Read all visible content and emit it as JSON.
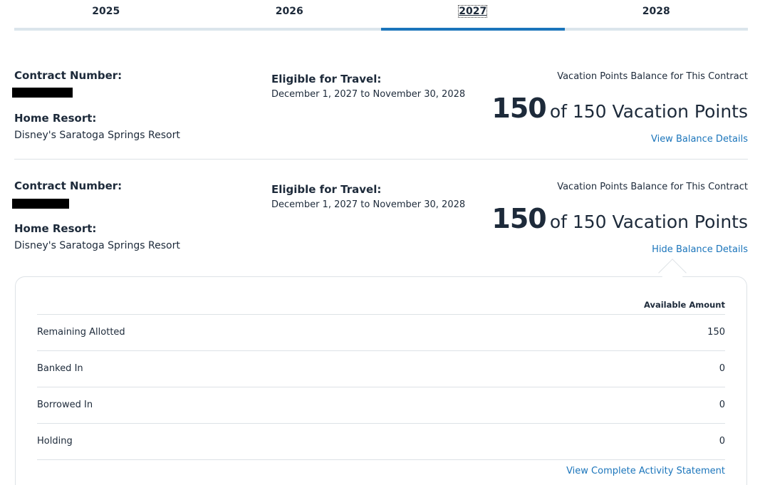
{
  "tabs": [
    {
      "label": "2025",
      "active": false
    },
    {
      "label": "2026",
      "active": false
    },
    {
      "label": "2027",
      "active": true
    },
    {
      "label": "2028",
      "active": false
    }
  ],
  "contracts": [
    {
      "contract_number_label": "Contract Number:",
      "contract_number_value": "[redacted]",
      "home_resort_label": "Home Resort:",
      "home_resort_value": "Disney's Saratoga Springs Resort",
      "eligible_label": "Eligible for Travel:",
      "eligible_value": "December 1, 2027 to November 30, 2028",
      "balance_title": "Vacation Points Balance for This Contract",
      "balance_points": "150",
      "balance_rest": "of 150 Vacation Points",
      "balance_link": "View Balance Details"
    },
    {
      "contract_number_label": "Contract Number:",
      "contract_number_value": "[redacted]",
      "home_resort_label": "Home Resort:",
      "home_resort_value": "Disney's Saratoga Springs Resort",
      "eligible_label": "Eligible for Travel:",
      "eligible_value": "December 1, 2027 to November 30, 2028",
      "balance_title": "Vacation Points Balance for This Contract",
      "balance_points": "150",
      "balance_rest": "of 150 Vacation Points",
      "balance_link": "Hide Balance Details"
    }
  ],
  "details": {
    "column_header": "Available Amount",
    "rows": [
      {
        "name": "Remaining Allotted",
        "amount": "150"
      },
      {
        "name": "Banked In",
        "amount": "0"
      },
      {
        "name": "Borrowed In",
        "amount": "0"
      },
      {
        "name": "Holding",
        "amount": "0"
      }
    ],
    "activity_link": "View Complete Activity Statement"
  },
  "colors": {
    "accent": "#1b75bb",
    "text": "#1d2a3a",
    "divider": "#dde2e6"
  }
}
